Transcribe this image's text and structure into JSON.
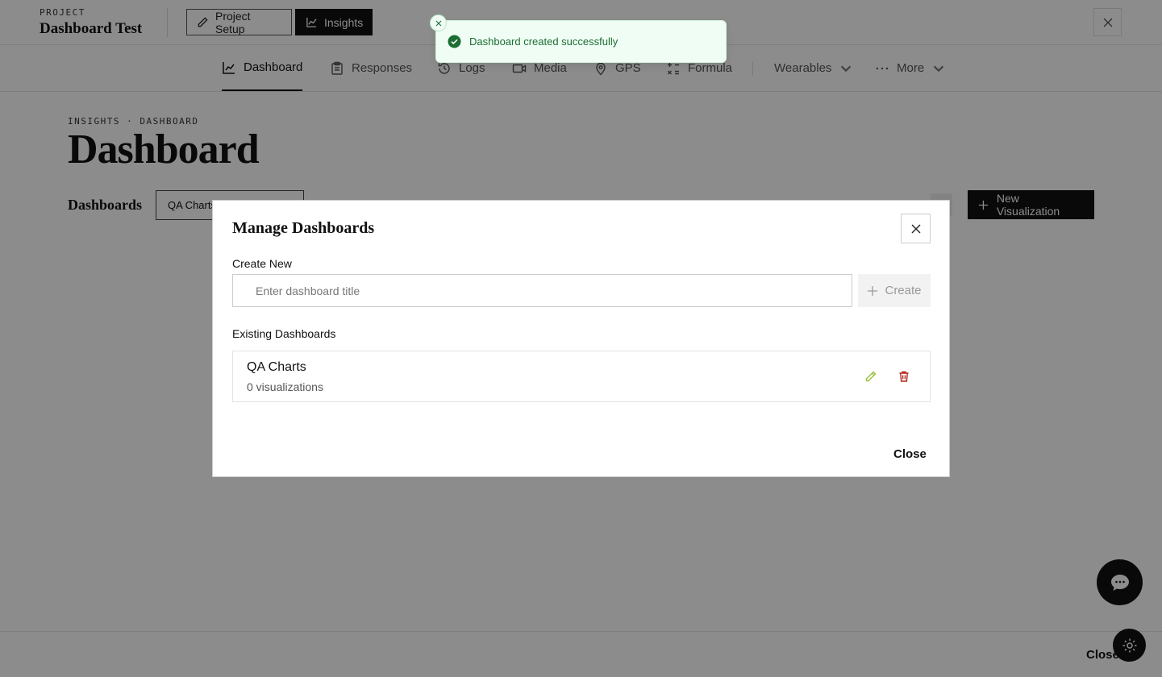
{
  "header": {
    "project_eyebrow": "PROJECT",
    "project_title": "Dashboard Test",
    "setup_label": "Project Setup",
    "insights_label": "Insights"
  },
  "tabs": [
    {
      "label": "Dashboard",
      "icon": "chart-line-icon",
      "active": true
    },
    {
      "label": "Responses",
      "icon": "clipboard-icon",
      "active": false
    },
    {
      "label": "Logs",
      "icon": "history-icon",
      "active": false
    },
    {
      "label": "Media",
      "icon": "video-icon",
      "active": false
    },
    {
      "label": "GPS",
      "icon": "map-pin-icon",
      "active": false
    },
    {
      "label": "Formula",
      "icon": "calculator-icon",
      "active": false
    },
    {
      "label": "Wearables",
      "icon": "chevron-down-icon",
      "active": false
    },
    {
      "label": "More",
      "icon": "ellipsis-icon",
      "active": false
    }
  ],
  "page": {
    "breadcrumb": "INSIGHTS · DASHBOARD",
    "title": "Dashboard",
    "dashboards_label": "Dashboards",
    "selected_dashboard": "QA Charts",
    "new_visualization_label": "New Visualization",
    "close_label": "Close"
  },
  "toast": {
    "message": "Dashboard created successfully",
    "color": "#1b6e32"
  },
  "modal": {
    "title": "Manage Dashboards",
    "create_label": "Create New",
    "input_placeholder": "Enter dashboard title",
    "input_value": "",
    "create_button": "Create",
    "existing_label": "Existing Dashboards",
    "dashboards": [
      {
        "name": "QA Charts",
        "count": "0 visualizations"
      }
    ],
    "close_button": "Close",
    "colors": {
      "edit": "#9bbf3a",
      "delete": "#b3261e"
    }
  }
}
